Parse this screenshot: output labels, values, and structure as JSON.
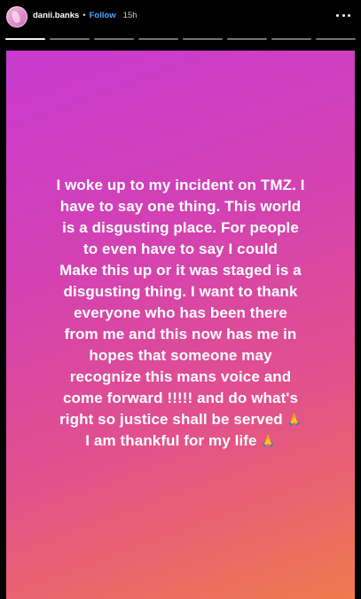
{
  "header": {
    "username": "danii.banks",
    "separator": "•",
    "follow_label": "Follow",
    "time": "15h"
  },
  "story": {
    "lines": [
      "I woke up to my incident on TMZ. I",
      "have to say one thing. This world",
      "is a disgusting place. For people",
      "to even have to say I could",
      "Make this up or it was staged is a",
      "disgusting thing. I want to thank",
      "everyone who has been there",
      "from me and this now has me in",
      "hopes that someone may",
      "recognize this mans voice and",
      "come forward !!!!!  and do what's",
      "right so justice shall be served",
      "I am thankful for my life"
    ],
    "emoji": "🙏"
  },
  "icons": {
    "avatar": "avatar",
    "more": "more-icon",
    "emoji": "folded-hands-icon"
  },
  "colors": {
    "gradient_start": "#c93bd0",
    "gradient_mid": "#e2508d",
    "gradient_end": "#f07a4e",
    "follow": "#4aa8ff"
  },
  "progress": {
    "segments": 8,
    "active_index": 0
  }
}
